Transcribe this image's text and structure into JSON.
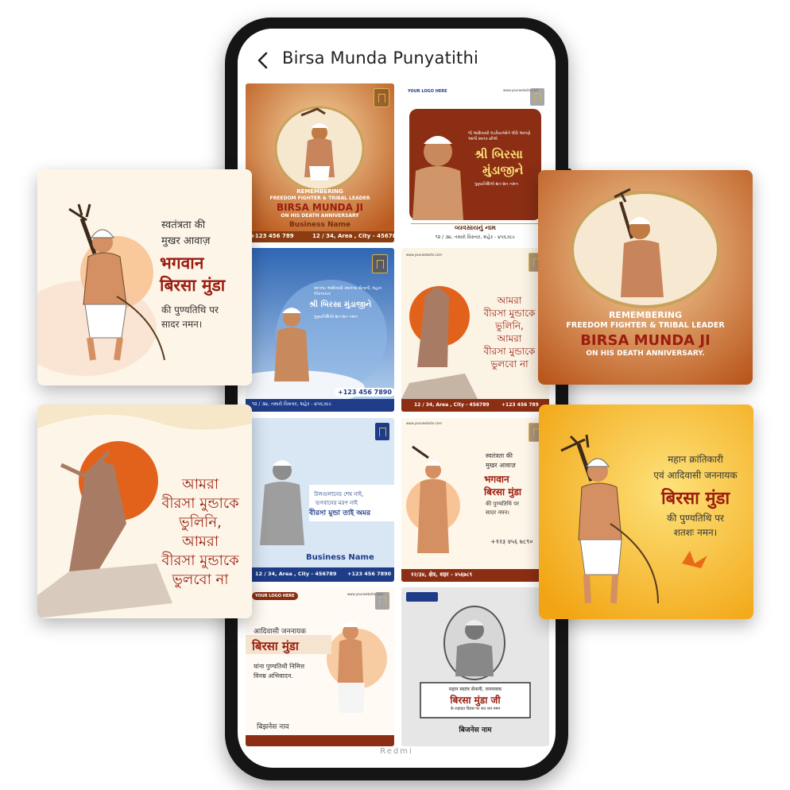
{
  "app": {
    "title": "Birsa Munda Punyatithi",
    "brand": "Redmi"
  },
  "colors": {
    "maroon": "#9b1d0f",
    "orange": "#e07a1c",
    "yellow": "#f6b21a",
    "blue": "#2f66b3"
  },
  "tiles": {
    "t1": {
      "line1": "REMEMBERING",
      "line2": "FREEDOM FIGHTER & TRIBAL LEADER",
      "name": "BIRSA MUNDA JI",
      "line3": "ON HIS DEATH ANNIVERSARY",
      "business": "Business Name",
      "phone": "+123 456 789",
      "address": "12 / 34, Area , City - 456789"
    },
    "t2": {
      "logo": "YOUR LOGO HERE",
      "website": "www.yourwebsite.com",
      "intro": "જે આદિવાસી લડવૈયાઓને લીધે આપણે આજે સ્વતંત્ર છીએ",
      "name1": "શ્રી બિરસા",
      "name2": "મુંડાજીને",
      "tribute": "પુણ્યતિથિએ શત શત નમન",
      "business": "વ્યવસાયનું નામ",
      "address": "૧૨ / ૩૪, તમારો વિસ્તાર, શહેર - ૪૫૬૭૮૯"
    },
    "t3": {
      "intro": "સ્વતંત્ર્ય આદિવાસી સ્વાતંત્ર્ય સેનાની, મહાન લોકનાયક",
      "name": "શ્રી બિરસા મુંડાજીને",
      "tribute": "પુણ્યતિથિએ શત શત નમન",
      "phone": "+123 456 7890",
      "address": "૧૨ / ૩૪, તમારો વિસ્તાર, શહેર - ૪૫૬૭૮૯"
    },
    "t4": {
      "website": "www.yourwebsite.com",
      "l1": "আমরা",
      "l2": "বীরসা মুন্ডাকে",
      "l3": "ভুলিনি,",
      "l4": "আমরা",
      "l5": "বীরসা মুন্ডাকে",
      "l6": "ভুলবো না",
      "address": "12 / 34, Area , City - 456789",
      "phone": "+123 456 789"
    },
    "t5": {
      "l1": "উলগুলানের শেষ নাই,",
      "l2": "ভগবানের মরণ নাই",
      "l3": "বীরসা মুন্ডা তাই অমর",
      "business": "Business Name",
      "address": "12 / 34, Area , City - 456789",
      "phone": "+123 456 7890"
    },
    "t6": {
      "website": "www.yourwebsite.com",
      "l1": "स्वतंत्रता की",
      "l2": "मुखर आवाज़",
      "l3": "भगवान",
      "l4": "बिरसा मुंडा",
      "l5": "की पुण्यतिथि पर",
      "l6": "सादर नमन।",
      "address": "१२/३४, क्षेत्र, शहर - ४५६७८९",
      "phone": "+१२३ ४५६ ७८९०"
    },
    "t7": {
      "logo": "YOUR LOGO HERE",
      "website": "www.yourwebsite.com",
      "l1": "आदिवासी जननायक",
      "l2": "बिरसा मुंडा",
      "l3": "यांना पुण्यतिथी निमित्त",
      "l4": "विनम्र अभिवादन.",
      "business": "बिझनेस नाव"
    },
    "t8": {
      "l1": "महान स्वतंत्र सेनानी, जननायक",
      "l2": "बिरसा मुंडा जी",
      "l3": "के शहादत दिवस पर शत शत नमन",
      "business": "बिजनेस नाम"
    }
  },
  "cards": {
    "c1": {
      "l1": "स्वतंत्रता की",
      "l2": "मुखर आवाज़",
      "l3": "भगवान",
      "l4": "बिरसा मुंडा",
      "l5": "की पुण्यतिथि पर",
      "l6": "सादर नमन।"
    },
    "c2": {
      "line1": "REMEMBERING",
      "line2": "FREEDOM FIGHTER & TRIBAL LEADER",
      "name": "BIRSA MUNDA JI",
      "line3": "ON HIS DEATH ANNIVERSARY."
    },
    "c3": {
      "l1": "আমরা",
      "l2": "বীরসা মুন্ডাকে",
      "l3": "ভুলিনি,",
      "l4": "আমরা",
      "l5": "বীরসা মুন্ডাকে",
      "l6": "ভুলবো না"
    },
    "c4": {
      "l1": "महान क्रांतिकारी",
      "l2": "एवं आदिवासी जननायक",
      "l3": "बिरसा मुंडा",
      "l4": "की पुण्यतिथि पर",
      "l5": "शतशः नमन।"
    }
  }
}
